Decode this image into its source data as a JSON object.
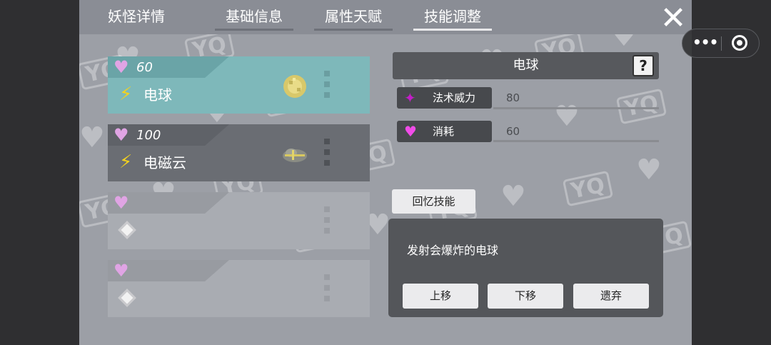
{
  "tabs": [
    {
      "label": "妖怪详情",
      "active": false
    },
    {
      "label": "基础信息",
      "active": false
    },
    {
      "label": "属性天赋",
      "active": false
    },
    {
      "label": "技能调整",
      "active": true
    }
  ],
  "close_icon": "close-icon",
  "watermark": {
    "text": "YQ"
  },
  "skills": [
    {
      "cost": "60",
      "name": "电球",
      "icon": "electric-ball-icon",
      "type_icon": "lightning-icon",
      "selected": true
    },
    {
      "cost": "100",
      "name": "电磁云",
      "icon": "electromagnetic-cloud-icon",
      "type_icon": "lightning-icon",
      "selected": false
    },
    {
      "cost": "",
      "name": "",
      "icon": "",
      "type_icon": "empty-gem-icon",
      "selected": false
    },
    {
      "cost": "",
      "name": "",
      "icon": "",
      "type_icon": "empty-gem-icon",
      "selected": false
    }
  ],
  "detail": {
    "title": "电球",
    "help_label": "?",
    "stats": [
      {
        "label": "法术威力",
        "value": "80",
        "icon": "magic-power-icon",
        "color": "#c21ec8"
      },
      {
        "label": "消耗",
        "value": "60",
        "icon": "heart-icon",
        "color": "#f04ce8"
      }
    ],
    "recall_label": "回忆技能",
    "description": "发射会爆炸的电球",
    "actions": [
      "上移",
      "下移",
      "遗弃"
    ]
  },
  "colors": {
    "selected_card": "#7eb8ba",
    "card": "#6a6d73",
    "panel": "#9c9fa6"
  }
}
